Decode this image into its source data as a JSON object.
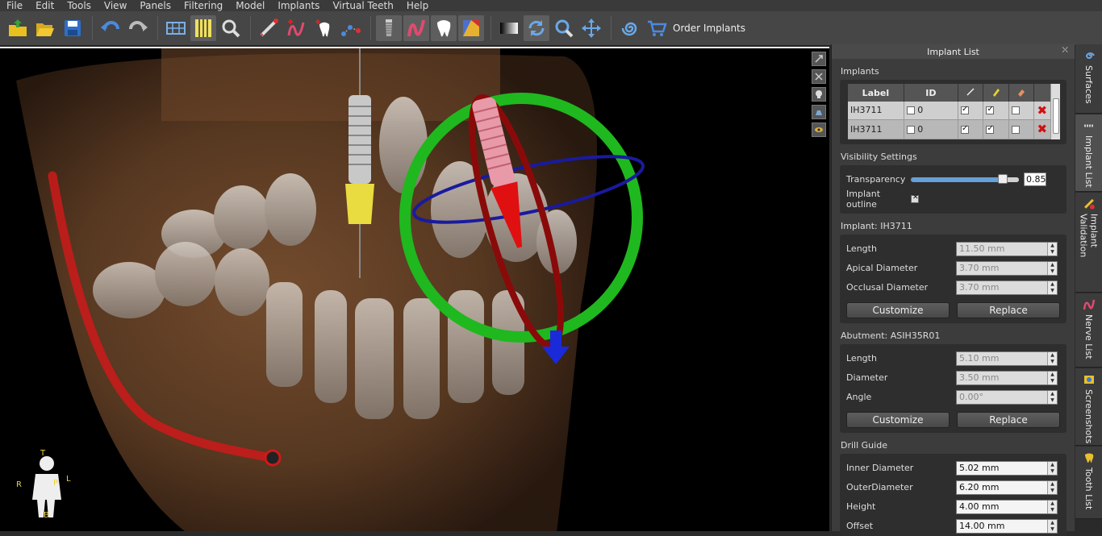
{
  "menu": [
    "File",
    "Edit",
    "Tools",
    "View",
    "Panels",
    "Filtering",
    "Model",
    "Implants",
    "Virtual Teeth",
    "Help"
  ],
  "toolbar": {
    "order_label": "Order Implants"
  },
  "panel": {
    "title": "Implant List",
    "implants_section": "Implants",
    "table": {
      "headers": [
        "Label",
        "ID"
      ],
      "rows": [
        {
          "label": "IH3711",
          "id": "0",
          "c1": true,
          "c2": true,
          "c3": false
        },
        {
          "label": "IH3711",
          "id": "0",
          "c1": true,
          "c2": true,
          "c3": false
        }
      ]
    },
    "visibility": {
      "title": "Visibility Settings",
      "transparency_label": "Transparency",
      "transparency_value": "0.85",
      "transparency_level": 0.85,
      "outline_label": "Implant outline"
    },
    "implant": {
      "title": "Implant: IH3711",
      "length_label": "Length",
      "length": "11.50 mm",
      "apical_label": "Apical Diameter",
      "apical": "3.70 mm",
      "occlusal_label": "Occlusal Diameter",
      "occlusal": "3.70 mm",
      "customize": "Customize",
      "replace": "Replace"
    },
    "abutment": {
      "title": "Abutment: ASIH35R01",
      "length_label": "Length",
      "length": "5.10 mm",
      "diameter_label": "Diameter",
      "diameter": "3.50 mm",
      "angle_label": "Angle",
      "angle": "0.00°",
      "customize": "Customize",
      "replace": "Replace"
    },
    "drill": {
      "title": "Drill Guide",
      "inner_label": "Inner Diameter",
      "inner": "5.02 mm",
      "outer_label": "OuterDiameter",
      "outer": "6.20 mm",
      "height_label": "Height",
      "height": "4.00 mm",
      "offset_label": "Offset",
      "offset": "14.00 mm"
    }
  },
  "vtabs": [
    "Surfaces",
    "Implant List",
    "Implant Validation",
    "Nerve List",
    "Screenshots",
    "Tooth List"
  ],
  "orientation": {
    "top": "T",
    "right": "R",
    "left": "L",
    "bottom": "B",
    "posterior": "P"
  },
  "colors": {
    "ring_green": "#1fb81f",
    "ring_blue": "#1a1a9e",
    "ring_red": "#8a0a0a",
    "nerve": "#cc1a1a"
  }
}
